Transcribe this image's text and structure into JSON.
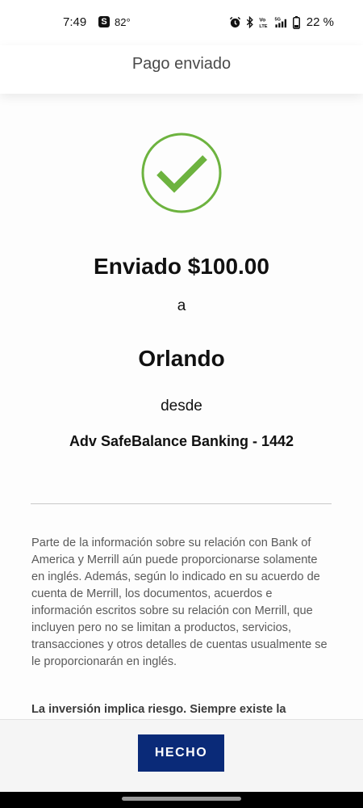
{
  "status_bar": {
    "time": "7:49",
    "app_badge": "S",
    "temperature": "82°",
    "battery": "22 %",
    "icons": [
      "alarm-icon",
      "bluetooth-icon",
      "volte-icon",
      "5g-signal-icon",
      "battery-icon"
    ]
  },
  "header": {
    "title": "Pago enviado"
  },
  "confirmation": {
    "icon": "success-check-icon",
    "sent_amount": "Enviado $100.00",
    "connector_to": "a",
    "recipient": "Orlando",
    "connector_from": "desde",
    "account": "Adv SafeBalance Banking - 1442"
  },
  "disclaimer": {
    "text": "Parte de la información sobre su relación con Bank of America y Merrill aún puede proporcionarse solamente en inglés. Además, según lo indicado en su acuerdo de cuenta de Merrill, los documentos, acuerdos e información escritos sobre su relación con Merrill, que incluyen pero no se limitan a productos, servicios, transacciones y otros detalles de cuentas usualmente se le proporcionarán en inglés.",
    "risk_text": "La inversión implica riesgo. Siempre existe la"
  },
  "footer": {
    "done_label": "HECHO"
  },
  "colors": {
    "accent_green": "#6db33f",
    "button_navy": "#0a2a78"
  }
}
